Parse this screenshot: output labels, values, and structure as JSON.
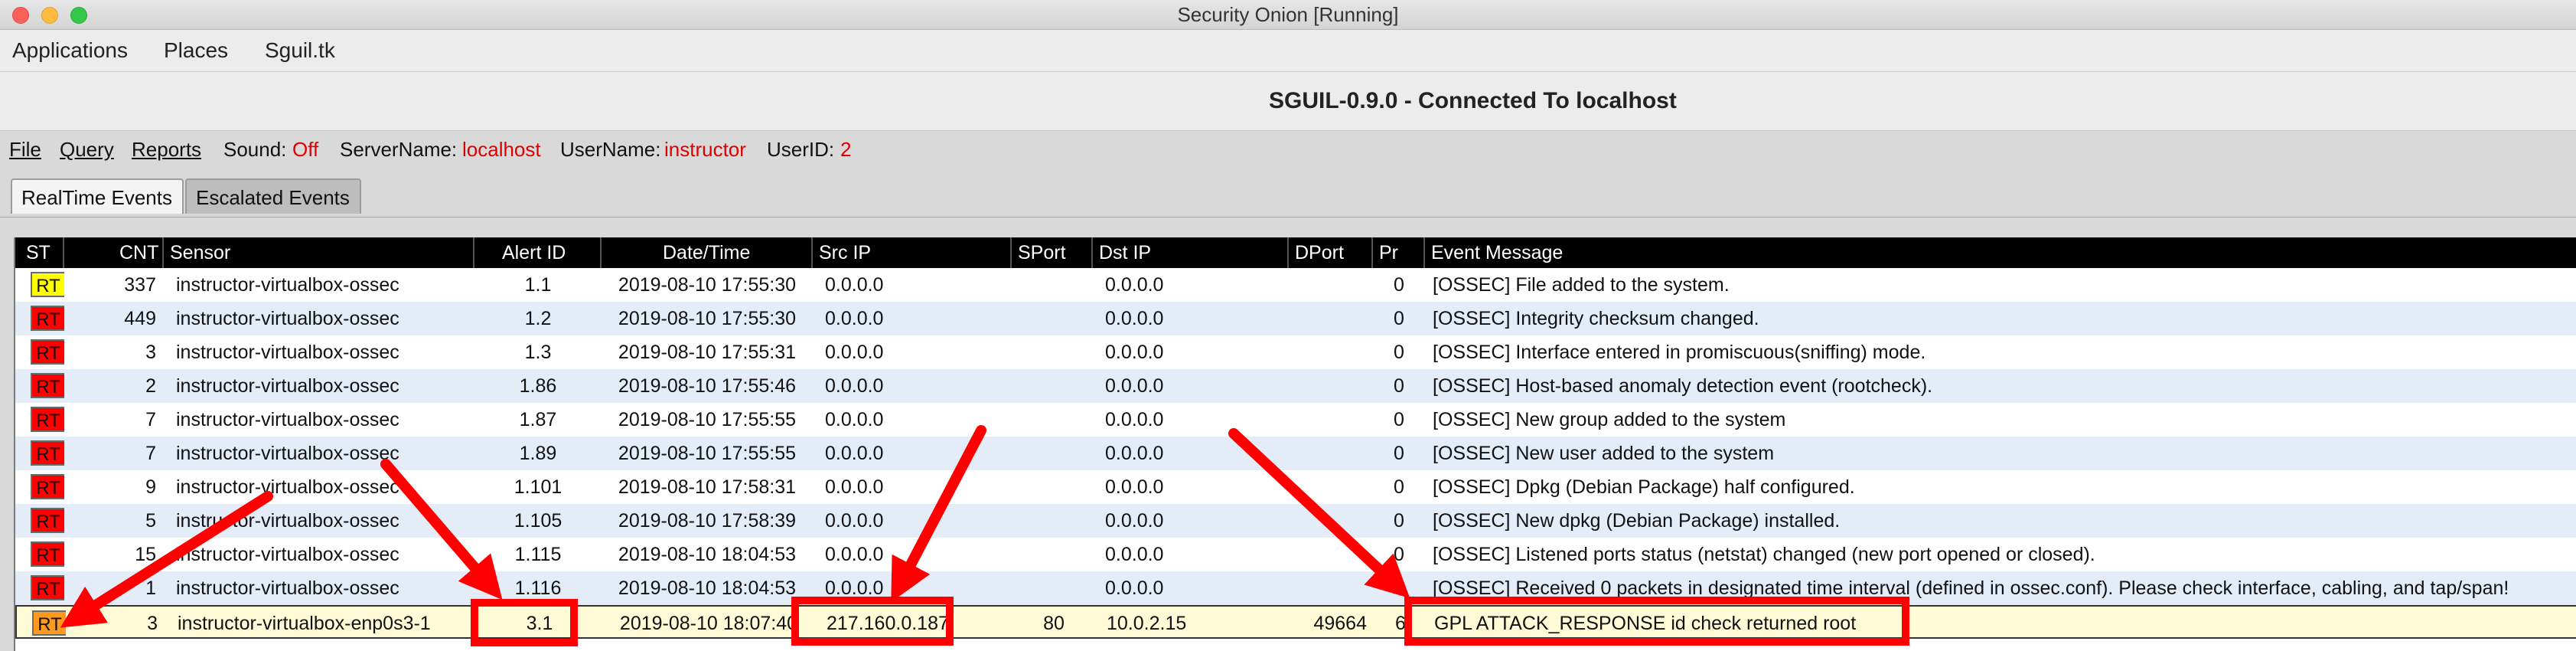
{
  "vm_window": {
    "title": "Security Onion [Running]"
  },
  "gnome_menu": [
    "Applications",
    "Places",
    "Sguil.tk"
  ],
  "sguil_window": {
    "title": "SGUIL-0.9.0 - Connected To localhost"
  },
  "sguil_menu": {
    "file": "File",
    "query": "Query",
    "reports": "Reports",
    "sound_label": "Sound:",
    "sound_value": "Off",
    "server_label": "ServerName:",
    "server_value": "localhost",
    "user_label": "UserName:",
    "user_value": "instructor",
    "userid_label": "UserID:",
    "userid_value": "2"
  },
  "tabs": [
    {
      "label": "RealTime Events",
      "active": true
    },
    {
      "label": "Escalated Events",
      "active": false
    }
  ],
  "columns": [
    "ST",
    "CNT",
    "Sensor",
    "Alert ID",
    "Date/Time",
    "Src IP",
    "SPort",
    "Dst IP",
    "DPort",
    "Pr",
    "Event Message"
  ],
  "colors": {
    "status_yellow": "#ffff00",
    "status_red": "#ff0000",
    "status_orange": "#ff9a1f",
    "annotation_red": "#ff0000"
  },
  "events": [
    {
      "st": "RT",
      "st_color": "#ffff00",
      "cnt": "337",
      "sensor": "instructor-virtualbox-ossec",
      "alert_id": "1.1",
      "datetime": "2019-08-10 17:55:30",
      "src_ip": "0.0.0.0",
      "sport": "",
      "dst_ip": "0.0.0.0",
      "dport": "",
      "pr": "0",
      "message": "[OSSEC] File added to the system."
    },
    {
      "st": "RT",
      "st_color": "#ff0000",
      "cnt": "449",
      "sensor": "instructor-virtualbox-ossec",
      "alert_id": "1.2",
      "datetime": "2019-08-10 17:55:30",
      "src_ip": "0.0.0.0",
      "sport": "",
      "dst_ip": "0.0.0.0",
      "dport": "",
      "pr": "0",
      "message": "[OSSEC] Integrity checksum changed."
    },
    {
      "st": "RT",
      "st_color": "#ff0000",
      "cnt": "3",
      "sensor": "instructor-virtualbox-ossec",
      "alert_id": "1.3",
      "datetime": "2019-08-10 17:55:31",
      "src_ip": "0.0.0.0",
      "sport": "",
      "dst_ip": "0.0.0.0",
      "dport": "",
      "pr": "0",
      "message": "[OSSEC] Interface entered in promiscuous(sniffing) mode."
    },
    {
      "st": "RT",
      "st_color": "#ff0000",
      "cnt": "2",
      "sensor": "instructor-virtualbox-ossec",
      "alert_id": "1.86",
      "datetime": "2019-08-10 17:55:46",
      "src_ip": "0.0.0.0",
      "sport": "",
      "dst_ip": "0.0.0.0",
      "dport": "",
      "pr": "0",
      "message": "[OSSEC] Host-based anomaly detection event (rootcheck)."
    },
    {
      "st": "RT",
      "st_color": "#ff0000",
      "cnt": "7",
      "sensor": "instructor-virtualbox-ossec",
      "alert_id": "1.87",
      "datetime": "2019-08-10 17:55:55",
      "src_ip": "0.0.0.0",
      "sport": "",
      "dst_ip": "0.0.0.0",
      "dport": "",
      "pr": "0",
      "message": "[OSSEC] New group added to the system"
    },
    {
      "st": "RT",
      "st_color": "#ff0000",
      "cnt": "7",
      "sensor": "instructor-virtualbox-ossec",
      "alert_id": "1.89",
      "datetime": "2019-08-10 17:55:55",
      "src_ip": "0.0.0.0",
      "sport": "",
      "dst_ip": "0.0.0.0",
      "dport": "",
      "pr": "0",
      "message": "[OSSEC] New user added to the system"
    },
    {
      "st": "RT",
      "st_color": "#ff0000",
      "cnt": "9",
      "sensor": "instructor-virtualbox-ossec",
      "alert_id": "1.101",
      "datetime": "2019-08-10 17:58:31",
      "src_ip": "0.0.0.0",
      "sport": "",
      "dst_ip": "0.0.0.0",
      "dport": "",
      "pr": "0",
      "message": "[OSSEC] Dpkg (Debian Package) half configured."
    },
    {
      "st": "RT",
      "st_color": "#ff0000",
      "cnt": "5",
      "sensor": "instructor-virtualbox-ossec",
      "alert_id": "1.105",
      "datetime": "2019-08-10 17:58:39",
      "src_ip": "0.0.0.0",
      "sport": "",
      "dst_ip": "0.0.0.0",
      "dport": "",
      "pr": "0",
      "message": "[OSSEC] New dpkg (Debian Package) installed."
    },
    {
      "st": "RT",
      "st_color": "#ff0000",
      "cnt": "15",
      "sensor": "instructor-virtualbox-ossec",
      "alert_id": "1.115",
      "datetime": "2019-08-10 18:04:53",
      "src_ip": "0.0.0.0",
      "sport": "",
      "dst_ip": "0.0.0.0",
      "dport": "",
      "pr": "0",
      "message": "[OSSEC] Listened ports status (netstat) changed (new port opened or closed)."
    },
    {
      "st": "RT",
      "st_color": "#ff0000",
      "cnt": "1",
      "sensor": "instructor-virtualbox-ossec",
      "alert_id": "1.116",
      "datetime": "2019-08-10 18:04:53",
      "src_ip": "0.0.0.0",
      "sport": "",
      "dst_ip": "0.0.0.0",
      "dport": "",
      "pr": "0",
      "message": "[OSSEC] Received 0 packets in designated time interval (defined in ossec.conf).  Please check interface, cabling, and tap/span!"
    },
    {
      "st": "RT",
      "st_color": "#ff9a1f",
      "cnt": "3",
      "sensor": "instructor-virtualbox-enp0s3-1",
      "alert_id": "3.1",
      "datetime": "2019-08-10 18:07:40",
      "src_ip": "217.160.0.187",
      "sport": "80",
      "dst_ip": "10.0.2.15",
      "dport": "49664",
      "pr": "6",
      "message": "GPL ATTACK_RESPONSE id check returned root",
      "selected": true
    }
  ]
}
